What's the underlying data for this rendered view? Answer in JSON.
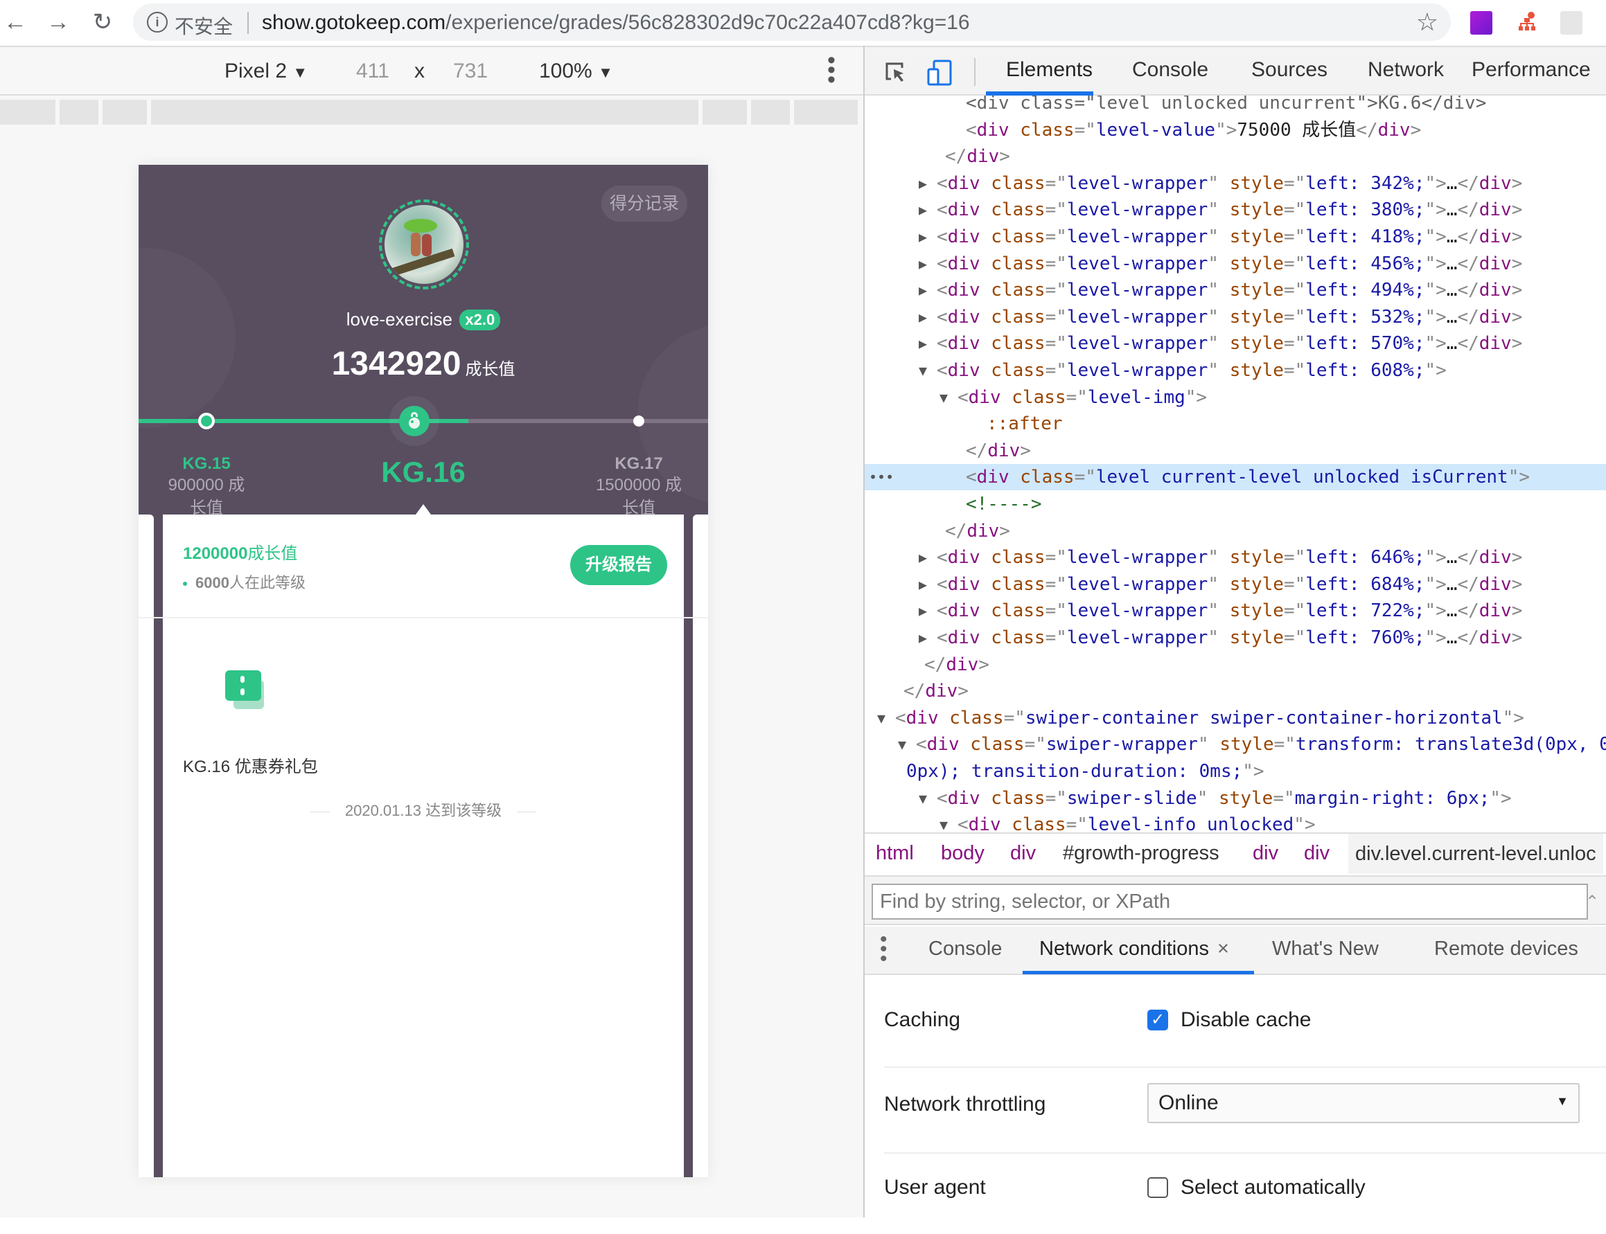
{
  "browser": {
    "back_icon": "arrow-left-icon",
    "forward_icon": "arrow-right-icon",
    "reload_icon": "reload-icon",
    "security_label": "不安全",
    "url_host": "show.gotokeep.com",
    "url_path": "/experience/grades/56c828302d9c70c22a407cd8?kg=16",
    "bookmark_icon": "star-icon",
    "extensions": [
      "axure-rp-extension-icon",
      "sitemap-extension-icon",
      "react-devtools-extension-icon"
    ]
  },
  "device_toolbar": {
    "device": "Pixel 2",
    "width": "411",
    "times": "x",
    "height": "731",
    "zoom": "100%"
  },
  "phone": {
    "score_record": "得分记录",
    "username": "love-exercise",
    "multiplier": "x2.0",
    "growth_value": "1342920",
    "growth_unit": "成长值",
    "progress_to_next_fraction": 0.24,
    "levels": {
      "prev": {
        "name": "KG.15",
        "value_line1": "900000 成",
        "value_line2": "长值"
      },
      "current": {
        "name": "KG.16"
      },
      "next": {
        "name": "KG.17",
        "value_line1": "1500000 成",
        "value_line2": "长值"
      }
    },
    "card": {
      "threshold_value": "1200000",
      "threshold_unit": "成长值",
      "people_count": "6000",
      "people_suffix": "人在此等级",
      "upgrade_button": "升级报告",
      "reward_label": "KG.16 优惠券礼包",
      "reached_text": "2020.01.13 达到该等级"
    }
  },
  "devtools": {
    "tabs": [
      "Elements",
      "Console",
      "Sources",
      "Network",
      "Performance"
    ],
    "active_tab": "Elements",
    "code_lines": [
      {
        "indent": 5,
        "html": "partial-top",
        "text": "<div class=\"level unlocked uncurrent\">KG.6</div>"
      },
      {
        "indent": 5,
        "text_parts": [
          "div",
          "level-value",
          "75000 成长值"
        ]
      },
      {
        "indent": 4,
        "close": "</div>"
      },
      {
        "wrapper_left": "342%"
      },
      {
        "wrapper_left": "380%"
      },
      {
        "wrapper_left": "418%"
      },
      {
        "wrapper_left": "456%"
      },
      {
        "wrapper_left": "494%"
      },
      {
        "wrapper_left": "532%"
      },
      {
        "wrapper_left": "570%"
      },
      {
        "wrapper_left_open": "608%"
      },
      {
        "class_open": "level-img"
      },
      {
        "pseudo": "::after"
      },
      {
        "close": "</div>"
      },
      {
        "selected_class": "level current-level unlocked isCurrent"
      },
      {
        "comment": "<!---->"
      },
      {
        "close": "</div>"
      },
      {
        "wrapper_left": "646%"
      },
      {
        "wrapper_left": "684%"
      },
      {
        "wrapper_left": "722%"
      },
      {
        "wrapper_left": "760%"
      },
      {
        "close": "</div>"
      },
      {
        "close": "</div>"
      },
      {
        "class_open": "swiper-container swiper-container-horizontal"
      },
      {
        "swiper_wrapper_style": "transform: translate3d(",
        "swiper_wrapper_style2": "0px); transition-duration: 0ms;"
      },
      {
        "slide_style": "margin-right: 6px;"
      },
      {
        "class_open": "level-info unlocked"
      }
    ],
    "code_text": {
      "level_value": "75000 成长值",
      "wrapper_class": "level-wrapper",
      "left_prefix": "left: ",
      "level_img": "level-img",
      "after": "::after",
      "current_class": "level current-level unlocked isCurrent",
      "comment": "<!---->",
      "swiper_container": "swiper-container swiper-container-horizontal",
      "swiper_wrapper": "swiper-wrapper",
      "swiper_wrapper_style": "transform: translate3",
      "swiper_wrapper_style2": "0px); transition-duration: 0ms;",
      "swiper_slide": "swiper-slide",
      "slide_style": "margin-right: 6px;",
      "level_info": "level-info unlocked",
      "top_partial": "<div class=\"level unlocked uncurrent\">KG.6</div>"
    },
    "wrapper_lefts_before": [
      "342%",
      "380%",
      "418%",
      "456%",
      "494%",
      "532%",
      "570%"
    ],
    "wrapper_left_open": "608%",
    "wrapper_lefts_after": [
      "646%",
      "684%",
      "722%",
      "760%"
    ],
    "breadcrumbs": [
      "html",
      "body",
      "div",
      "#growth-progress",
      "div",
      "div",
      "div.level.current-level.unloc"
    ],
    "search_placeholder": "Find by string, selector, or XPath",
    "drawer_tabs": [
      "Console",
      "Network conditions",
      "What's New",
      "Remote devices"
    ],
    "drawer_active": "Network conditions",
    "network_conditions": {
      "caching_label": "Caching",
      "disable_cache_label": "Disable cache",
      "disable_cache_checked": true,
      "throttling_label": "Network throttling",
      "throttling_value": "Online",
      "user_agent_label": "User agent",
      "select_auto_label": "Select automatically",
      "select_auto_checked": false
    }
  },
  "colors": {
    "accent_green": "#2ec487",
    "header_purple": "#584e60",
    "devtools_blue": "#1a73e8"
  }
}
